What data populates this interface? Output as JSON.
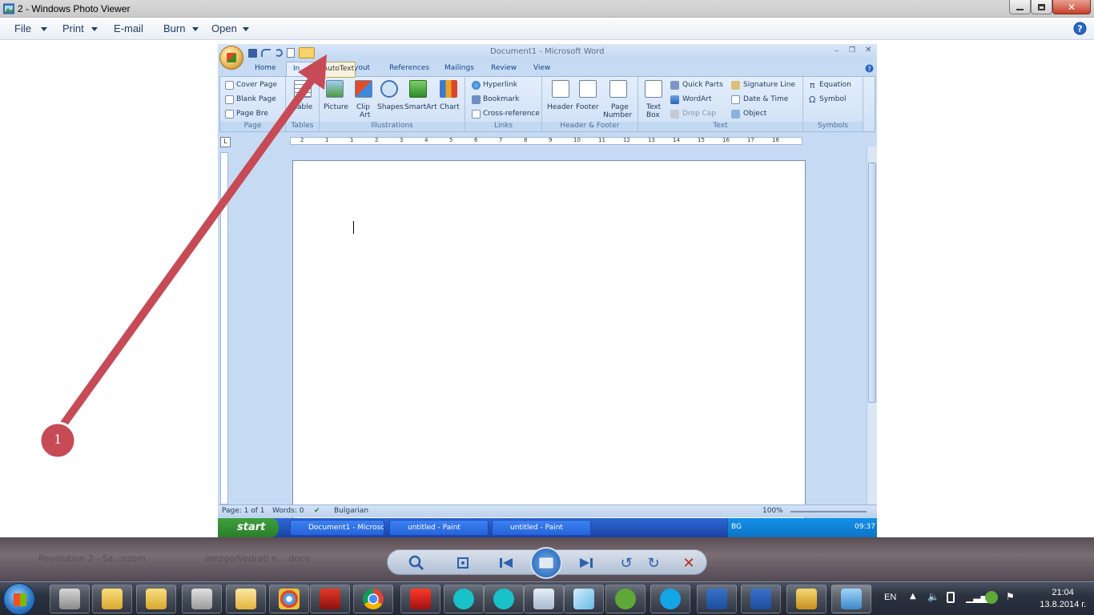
{
  "viewer": {
    "title": "2 - Windows Photo Viewer",
    "menu": {
      "file": "File",
      "print": "Print",
      "email": "E-mail",
      "burn": "Burn",
      "open": "Open"
    }
  },
  "word": {
    "title": "Document1 - Microsoft Word",
    "tabs": {
      "home": "Home",
      "insert": "In",
      "layout": "yout",
      "references": "References",
      "mailings": "Mailings",
      "review": "Review",
      "view": "View"
    },
    "tooltip": "AutoText",
    "ribbon": {
      "pages": {
        "cover": "Cover Page",
        "blank": "Blank Page",
        "break": "Page Bre",
        "label": "Page"
      },
      "tables": {
        "table": "Table",
        "label": "Tables"
      },
      "illustrations": {
        "picture": "Picture",
        "clip": "Clip",
        "clip2": "Art",
        "shapes": "Shapes",
        "smartart": "SmartArt",
        "chart": "Chart",
        "label": "Illustrations"
      },
      "links": {
        "hyperlink": "Hyperlink",
        "bookmark": "Bookmark",
        "crossref": "Cross-reference",
        "label": "Links"
      },
      "headerfooter": {
        "header": "Header",
        "footer": "Footer",
        "pagenum": "Page",
        "pagenum2": "Number",
        "label": "Header & Footer"
      },
      "text": {
        "textbox": "Text",
        "textbox2": "Box",
        "quickparts": "Quick Parts",
        "wordart": "WordArt",
        "dropcap": "Drop Cap",
        "sigline": "Signature Line",
        "datetime": "Date & Time",
        "object": "Object",
        "label": "Text"
      },
      "symbols": {
        "equation": "Equation",
        "symbol": "Symbol",
        "label": "Symbols"
      }
    },
    "ruler": [
      "2",
      "1",
      "1",
      "2",
      "3",
      "4",
      "5",
      "6",
      "7",
      "8",
      "9",
      "10",
      "11",
      "12",
      "13",
      "14",
      "15",
      "16",
      "17",
      "18"
    ],
    "status": {
      "page": "Page: 1 of 1",
      "words": "Words: 0",
      "lang": "Bulgarian",
      "zoom": "100%"
    }
  },
  "xp_taskbar": {
    "start": "start",
    "items": [
      "Document1 - Microsof...",
      "untitled - Paint",
      "untitled - Paint"
    ],
    "tray_lang": "BG",
    "time": "09:37"
  },
  "annotation": {
    "number": "1"
  },
  "background_tabs": [
    "Revolution 2 - Sa...ozom",
    "amzge/Vedrati n... doco"
  ],
  "taskbar": {
    "lang": "EN",
    "time": "21:04",
    "date": "13.8.2014 г."
  }
}
